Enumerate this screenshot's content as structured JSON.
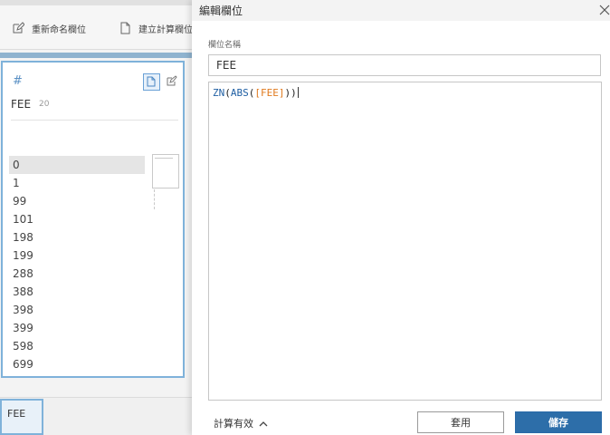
{
  "toolbar": {
    "rename_label": "重新命名欄位",
    "create_calc_label": "建立計算欄位"
  },
  "profile_card": {
    "type_icon": "#",
    "field_name": "FEE",
    "count": "20",
    "values": [
      "0",
      "1",
      "99",
      "101",
      "198",
      "199",
      "288",
      "388",
      "398",
      "399",
      "598",
      "699"
    ]
  },
  "bottom_tab": {
    "label": "FEE"
  },
  "dialog": {
    "title": "編輯欄位",
    "name_label": "欄位名稱",
    "name_value": "FEE",
    "formula": {
      "fn1": "ZN",
      "p1": "(",
      "fn2": "ABS",
      "p2": "(",
      "field": "[FEE]",
      "p3": "))"
    },
    "calc_status": "計算有效",
    "apply_label": "套用",
    "save_label": "儲存"
  },
  "colors": {
    "accent": "#2d6ea9",
    "card_border": "#7fb2da",
    "field_ref": "#e07a1f",
    "function": "#1f5fa3"
  }
}
